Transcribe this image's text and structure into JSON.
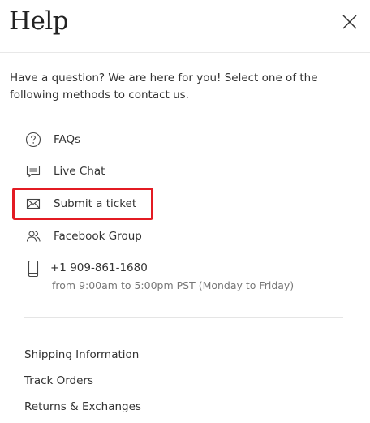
{
  "header": {
    "title": "Help",
    "close_icon": "close-icon"
  },
  "intro_text": "Have a question? We are here for you! Select one of the following methods to contact us.",
  "methods": [
    {
      "label": "FAQs",
      "icon": "question-circle-icon"
    },
    {
      "label": "Live Chat",
      "icon": "chat-icon"
    },
    {
      "label": "Submit a ticket",
      "icon": "envelope-icon",
      "highlighted": true
    },
    {
      "label": "Facebook Group",
      "icon": "group-icon"
    },
    {
      "label": "+1 909-861-1680",
      "icon": "phone-icon",
      "sub": "from 9:00am to 5:00pm PST (Monday to Friday)"
    }
  ],
  "links": [
    {
      "label": "Shipping Information"
    },
    {
      "label": "Track Orders"
    },
    {
      "label": "Returns & Exchanges"
    }
  ],
  "colors": {
    "highlight": "#e31b23",
    "text": "#333333",
    "muted": "#777777",
    "divider": "#e5e5e5"
  }
}
